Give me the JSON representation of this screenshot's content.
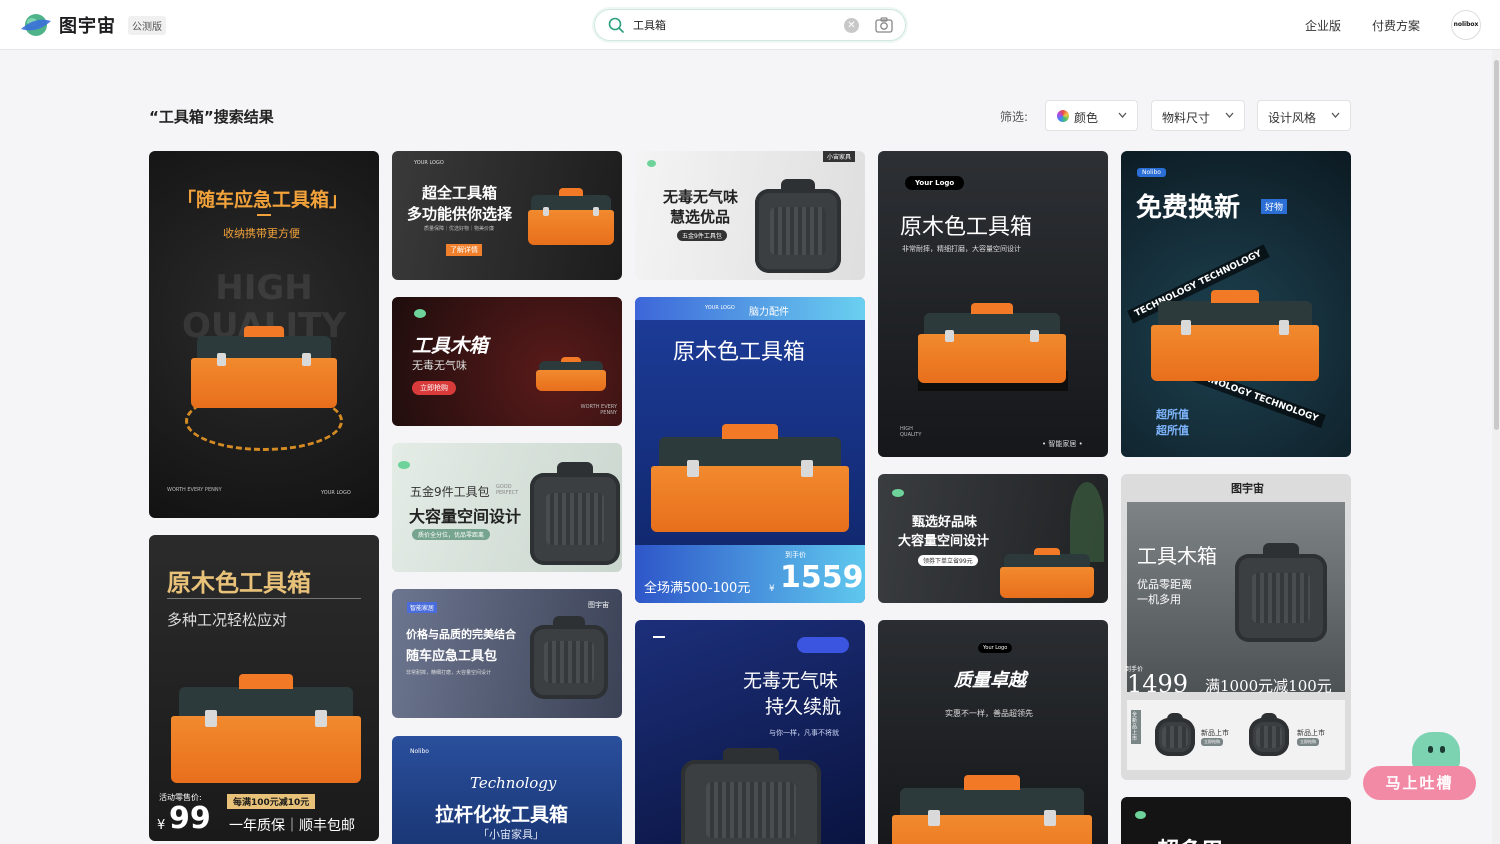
{
  "header": {
    "brand": "图宇宙",
    "beta_badge": "公测版",
    "search": {
      "value": "工具箱",
      "placeholder": ""
    },
    "nav": {
      "enterprise": "企业版",
      "pricing": "付费方案"
    },
    "avatar_text": "nolibox"
  },
  "results": {
    "title": "“工具箱”搜索结果",
    "filter_label": "筛选:",
    "filters": [
      {
        "label": "颜色"
      },
      {
        "label": "物料尺寸"
      },
      {
        "label": "设计风格"
      }
    ]
  },
  "cards": {
    "c1": {
      "title": "「随车应急工具箱」",
      "subtitle": "收纳携带更方便",
      "bg_text": "HIGH QUALITY",
      "foot_left": "WORTH EVERY PENNY",
      "foot_right": "YOUR LOGO"
    },
    "c2": {
      "title": "原木色工具箱",
      "subtitle": "多种工况轻松应对",
      "price_label": "活动零售价:",
      "promo": "每满100元减10元",
      "currency": "¥",
      "price": "99",
      "slogan": "一年质保｜顺丰包邮"
    },
    "c3": {
      "logo": "YOUR LOGO",
      "line1": "超全工具箱",
      "line2": "多功能供你选择",
      "small": "质量保障｜优选好物｜物美价廉",
      "btn": "了解详情"
    },
    "c4": {
      "title": "工具木箱",
      "subtitle": "无毒无气味",
      "btn": "立即抢购",
      "foot": "WORTH EVERY PENNY"
    },
    "c5": {
      "line1": "五金9件工具包",
      "line2": "大容量空间设计",
      "pill": "质价全分位，优品零距离",
      "tag": "GOOD PERFECT"
    },
    "c6": {
      "tag": "智能家居",
      "logo": "图宇宙",
      "line1": "价格与品质的完美结合",
      "line2": "随车应急工具包",
      "small": "非常耐摔，精细打磨，大容量空间设计"
    },
    "c7": {
      "line1": "Technology",
      "line2": "拉杆化妆工具箱",
      "line3": "「小宙家具」",
      "logo": "Nolibo"
    },
    "c8": {
      "tag": "小宙家具",
      "line1": "无毒无气味",
      "line2": "慧选优品",
      "pill": "五金9件工具包"
    },
    "c9": {
      "logo": "YOUR LOGO",
      "tag": "脑力配件",
      "title": "原木色工具箱",
      "promo": "全场满500-100元",
      "price_label": "到手价",
      "currency": "¥",
      "price": "1559"
    },
    "c10": {
      "line1": "无毒无气味",
      "line2": "持久续航",
      "small": "与你一样，凡事不将就"
    },
    "c11": {
      "logo": "Your Logo",
      "title": "原木色工具箱",
      "small": "非常耐摔，精细打磨，大容量空间设计",
      "foot_left": "HIGH QUALITY",
      "foot_right": "• 智能家居 •"
    },
    "c12": {
      "line1": "甄选好品味",
      "line2": "大容量空间设计",
      "pill": "领券下单立省99元"
    },
    "c13": {
      "logo": "Your Logo",
      "title": "质量卓越",
      "small": "实惠不一样，善品超领先"
    },
    "c14": {
      "logo": "Nolibo",
      "title": "免费换新",
      "badge": "好物",
      "band1": "TECHNOLOGY TECHNOLOGY",
      "band2": "TECHNOLOGY TECHNOLOGY",
      "value1": "超所值",
      "value2": "超所值"
    },
    "c15": {
      "logo": "图宇宙",
      "title": "工具木箱",
      "sub1": "优品零距离",
      "sub2": "一机多用",
      "price_label": "到手价",
      "price": "1499",
      "promo": "满1000元减100元",
      "vert": "全新品上市",
      "mini1": "新品上市",
      "mini2": "新品上市",
      "mini_btn": "立即抢购"
    },
    "c16": {
      "title": "超多用"
    }
  },
  "feedback": {
    "label": "马上吐槽"
  }
}
